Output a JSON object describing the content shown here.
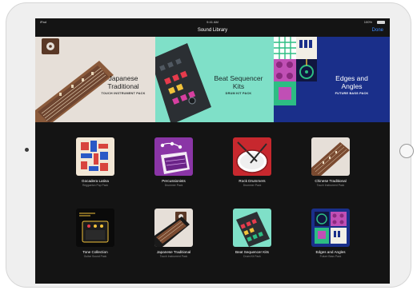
{
  "status": {
    "carrier": "iPad",
    "time": "9:41 AM",
    "battery": "100%"
  },
  "nav": {
    "title": "Sound Library",
    "done": "Done"
  },
  "banners": [
    {
      "title1": "Japanese",
      "title2": "Traditional",
      "subtitle": "TOUCH INSTRUMENT PACK"
    },
    {
      "title1": "Beat Sequencer",
      "title2": "Kits",
      "subtitle": "DRUM KIT PACK"
    },
    {
      "title1": "Edges and",
      "title2": "Angles",
      "subtitle": "FUTURE BASS PACK"
    }
  ],
  "packs": [
    {
      "name": "Gocadera Latina",
      "type": "Reggaeton Pop Pack"
    },
    {
      "name": "Percussionists",
      "type": "Drummer Pack"
    },
    {
      "name": "Rock Drummers",
      "type": "Drummer Pack"
    },
    {
      "name": "Chinese Traditional",
      "type": "Touch Instrument Pack"
    },
    {
      "name": "Tone Collection",
      "type": "Guitar Sound Pack"
    },
    {
      "name": "Japanese Traditional",
      "type": "Touch Instrument Pack"
    },
    {
      "name": "Beat Sequencer Kits",
      "type": "Drum Kit Pack"
    },
    {
      "name": "Edges and Angles",
      "type": "Future Bass Pack"
    }
  ],
  "colors": {
    "screen_bg": "#141414",
    "accent": "#3f8bff",
    "banner1": "#e6dfd8",
    "banner2": "#7fe0c8",
    "banner3": "#1a2f8a"
  }
}
